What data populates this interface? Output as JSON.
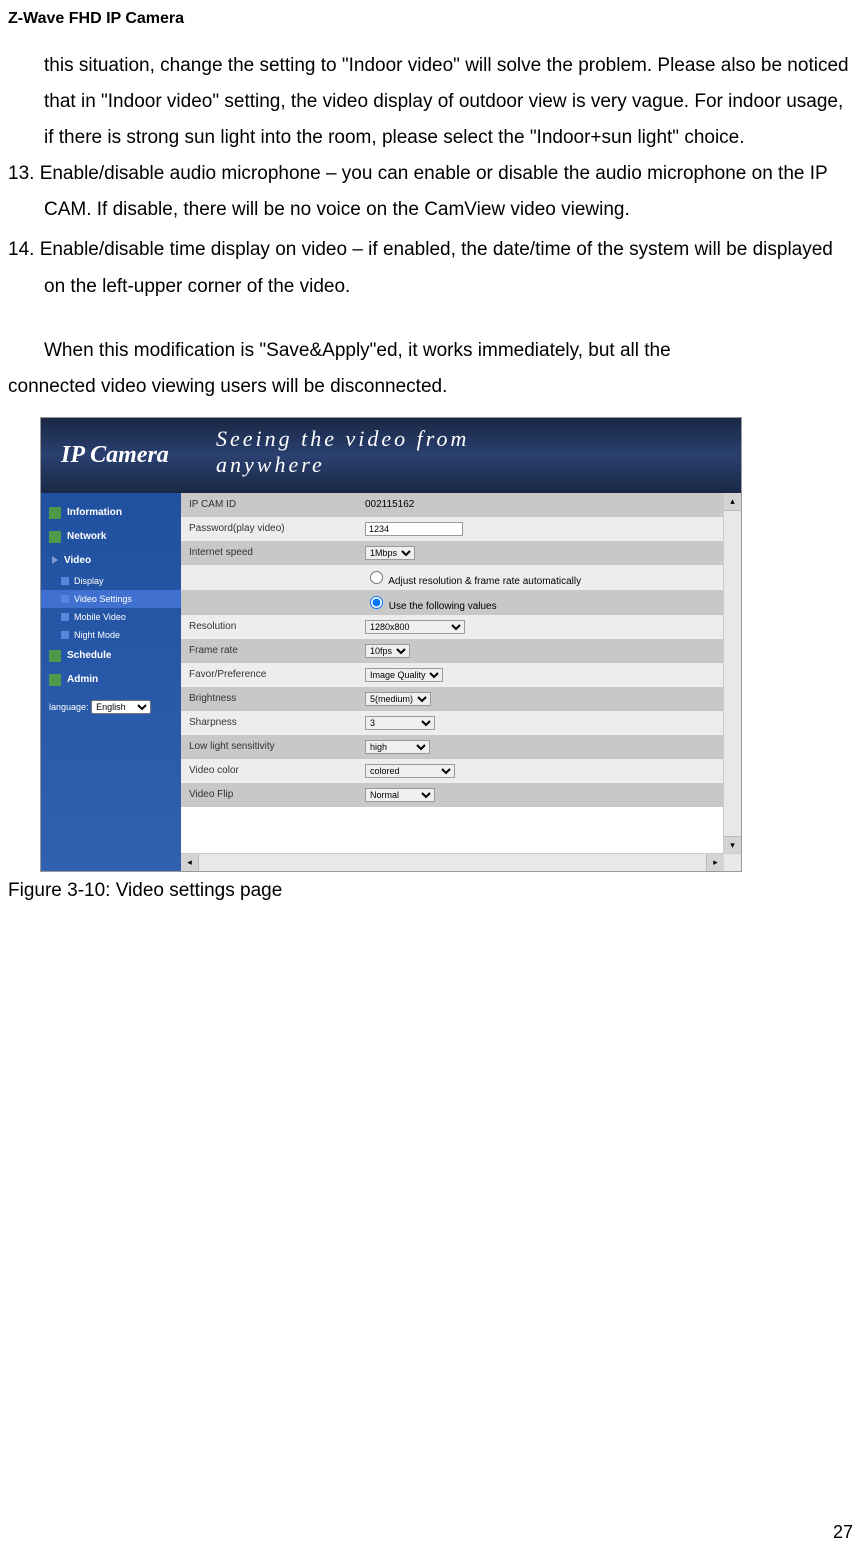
{
  "header": "Z-Wave FHD IP Camera",
  "body": {
    "continuation_text": "this situation, change the setting to \"Indoor video\" will solve the problem. Please also be noticed that in \"Indoor video\" setting, the video display of outdoor view is very vague. For indoor usage, if there is strong sun light into the room, please select the \"Indoor+sun light\" choice.",
    "item13": "13. Enable/disable audio microphone – you can enable or disable the audio microphone on the IP CAM. If disable, there will be no voice on the CamView video viewing.",
    "item14": "14. Enable/disable time display on video – if enabled, the date/time of the system will be displayed on the left-upper corner of the video.",
    "closing1": "When this modification is \"Save&Apply\"ed, it works immediately, but all the",
    "closing2": "connected video viewing users will be disconnected."
  },
  "screenshot": {
    "banner": {
      "logo": "IP Camera",
      "tagline": "Seeing the video from anywhere"
    },
    "sidebar": {
      "items": [
        "Information",
        "Network",
        "Video",
        "Schedule",
        "Admin"
      ],
      "video_sub": [
        "Display",
        "Video Settings",
        "Mobile Video",
        "Night Mode"
      ],
      "language_label": "language:",
      "language_value": "English"
    },
    "settings": {
      "rows": [
        {
          "label": "IP CAM ID",
          "value": "002115162",
          "type": "text"
        },
        {
          "label": "Password(play video)",
          "value": "1234",
          "type": "input"
        },
        {
          "label": "Internet speed",
          "value": "1Mbps",
          "type": "select"
        },
        {
          "label": "",
          "value": "Adjust resolution & frame rate automatically",
          "type": "radio",
          "checked": false
        },
        {
          "label": "",
          "value": "Use the following values",
          "type": "radio",
          "checked": true
        },
        {
          "label": "Resolution",
          "value": "1280x800",
          "type": "select"
        },
        {
          "label": "Frame rate",
          "value": "10fps",
          "type": "select"
        },
        {
          "label": "Favor/Preference",
          "value": "Image Quality",
          "type": "select"
        },
        {
          "label": "Brightness",
          "value": "5(medium)",
          "type": "select"
        },
        {
          "label": "Sharpness",
          "value": "3",
          "type": "select"
        },
        {
          "label": "Low light sensitivity",
          "value": "high",
          "type": "select"
        },
        {
          "label": "Video color",
          "value": "colored",
          "type": "select"
        },
        {
          "label": "Video Flip",
          "value": "Normal",
          "type": "select"
        }
      ]
    }
  },
  "caption": "Figure 3-10: Video settings page",
  "page_number": "27"
}
